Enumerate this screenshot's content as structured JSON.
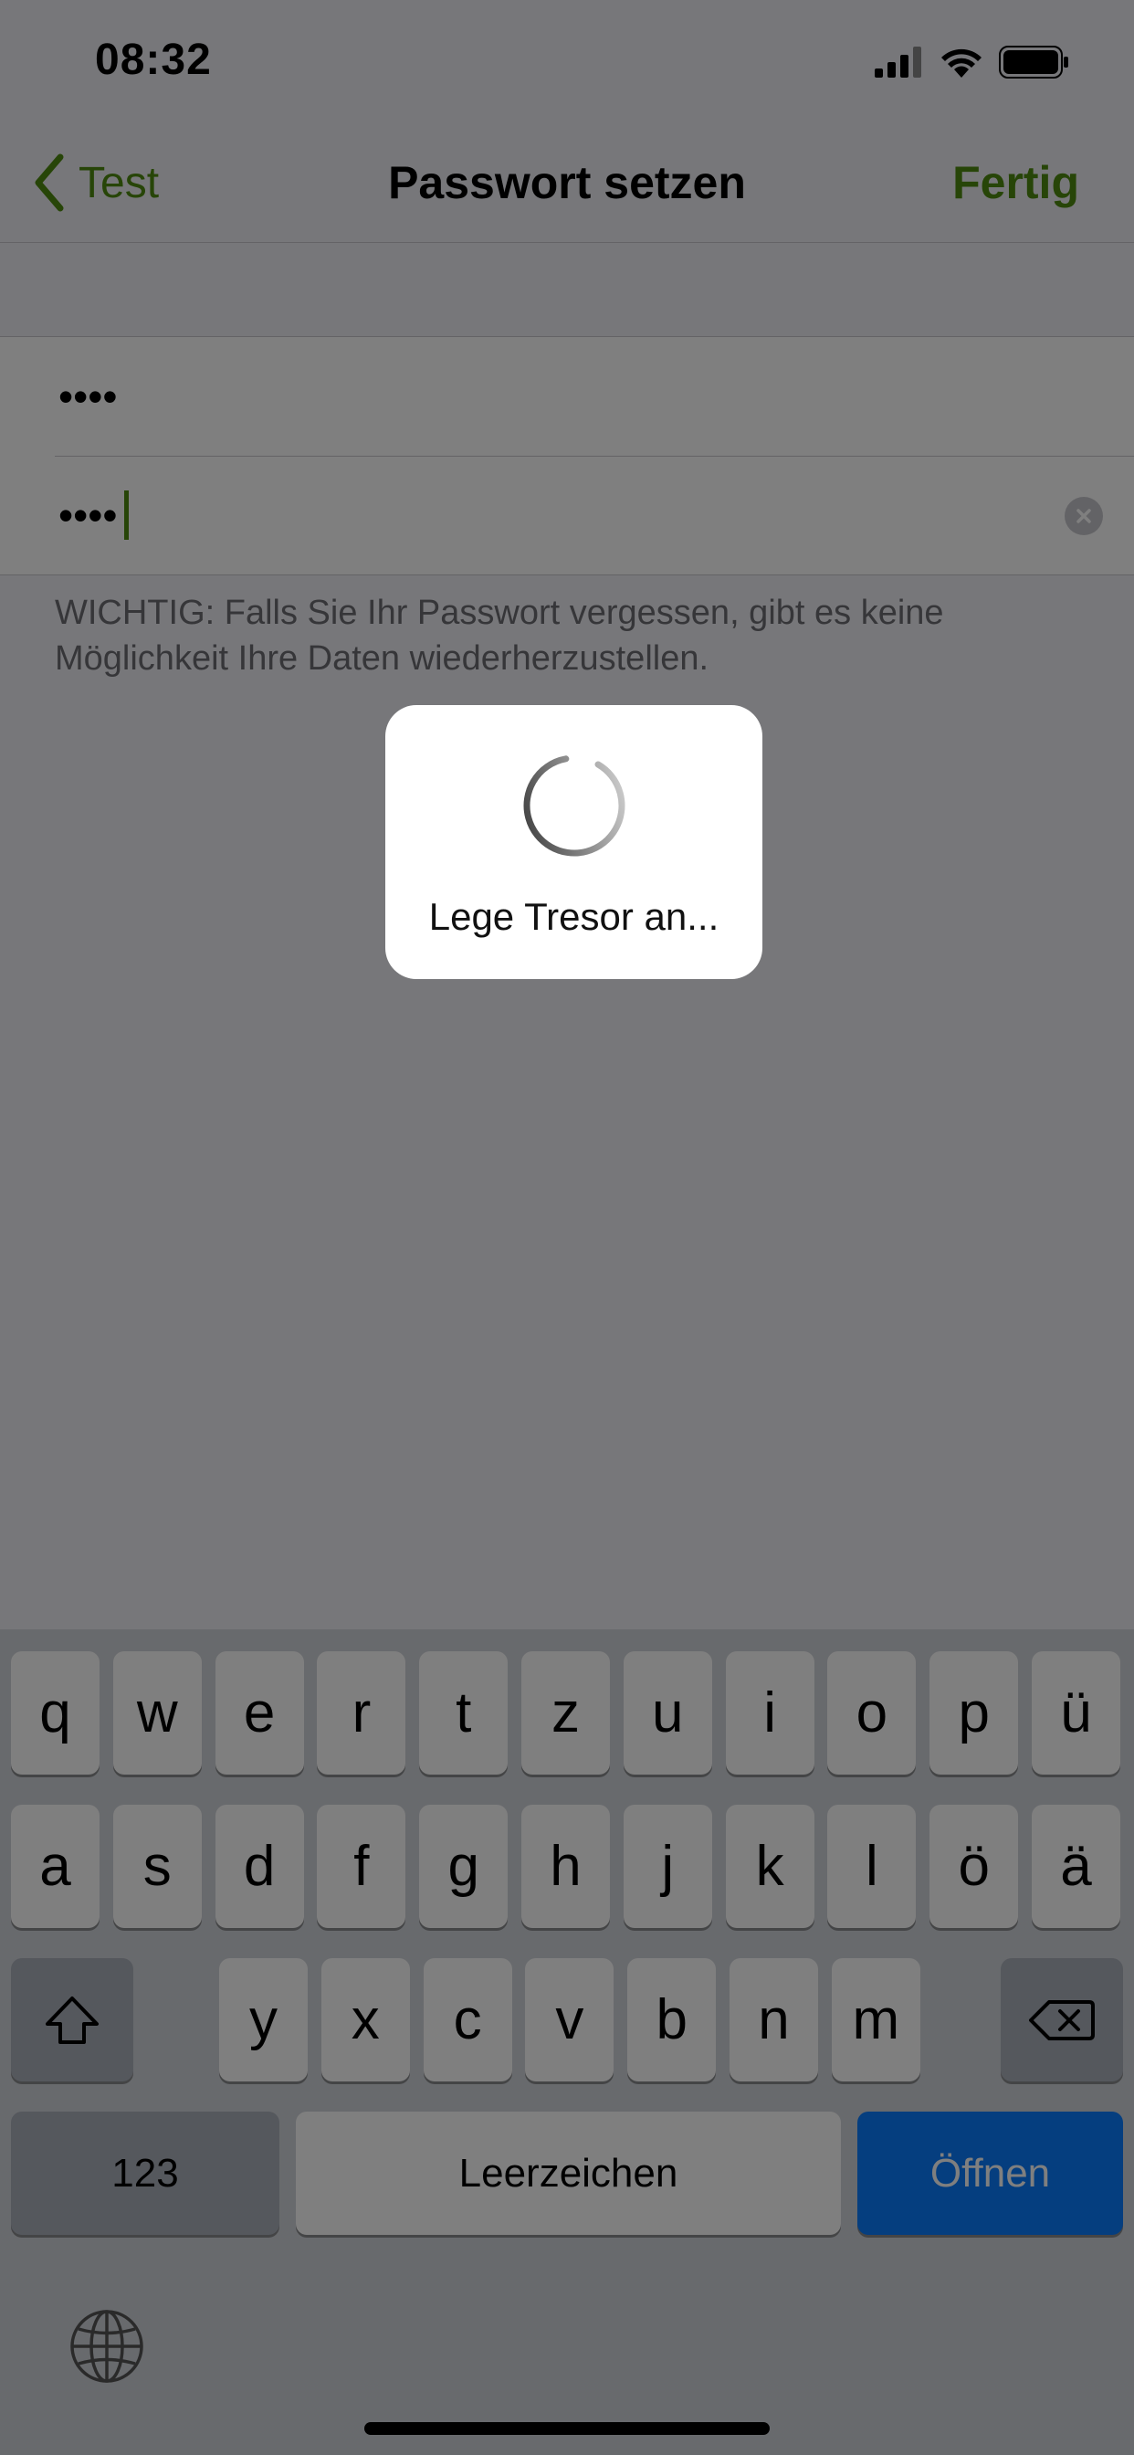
{
  "status_bar": {
    "time": "08:32"
  },
  "nav": {
    "back_label": "Test",
    "title": "Passwort setzen",
    "done_label": "Fertig"
  },
  "form": {
    "password_dots": "••••",
    "confirm_dots": "••••",
    "footer_note": "WICHTIG: Falls Sie Ihr Passwort vergessen, gibt es keine Möglichkeit Ihre Daten wiederherzustellen."
  },
  "hud": {
    "label": "Lege Tresor an..."
  },
  "keyboard": {
    "row1": [
      "q",
      "w",
      "e",
      "r",
      "t",
      "z",
      "u",
      "i",
      "o",
      "p",
      "ü"
    ],
    "row2": [
      "a",
      "s",
      "d",
      "f",
      "g",
      "h",
      "j",
      "k",
      "l",
      "ö",
      "ä"
    ],
    "row3": [
      "y",
      "x",
      "c",
      "v",
      "b",
      "n",
      "m"
    ],
    "numbers_label": "123",
    "space_label": "Leerzeichen",
    "return_label": "Öffnen"
  },
  "colors": {
    "accent": "#4f8a10",
    "return_key": "#0a7cff"
  }
}
